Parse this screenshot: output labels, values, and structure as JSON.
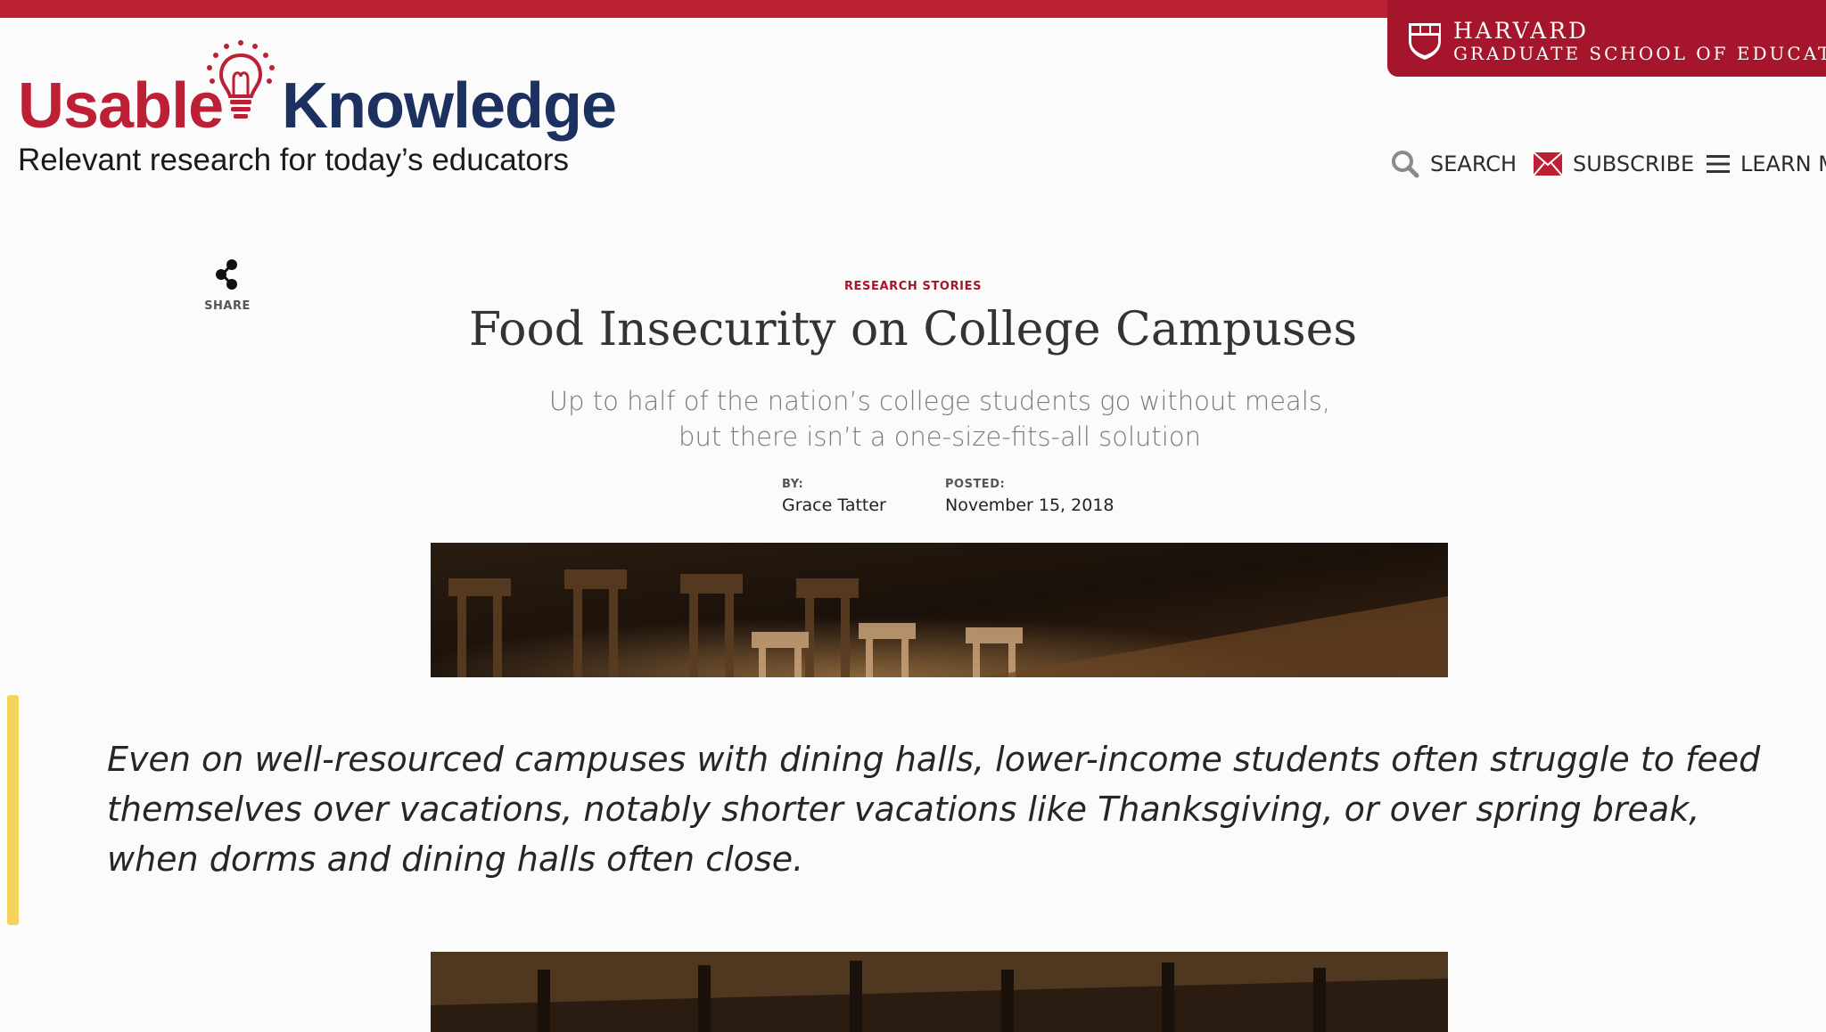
{
  "header": {
    "hgse_line1": "HARVARD",
    "hgse_line2": "GRADUATE SCHOOL OF EDUCATION",
    "logo_left": "Usable",
    "logo_right": "Knowledge",
    "tagline": "Relevant research for today’s educators"
  },
  "nav": {
    "search": "SEARCH",
    "subscribe": "SUBSCRIBE",
    "learn_more": "LEARN MORE"
  },
  "share": {
    "label": "SHARE"
  },
  "article": {
    "category": "RESEARCH STORIES",
    "title": "Food Insecurity on College Campuses",
    "subtitle": "Up to half of the nation’s college students go without meals, but there isn’t a one-size-fits-all solution",
    "by_label": "BY:",
    "author": "Grace Tatter",
    "posted_label": "POSTED:",
    "date": "November 15, 2018",
    "pull_quote": "Even on well-resourced campuses with dining halls, lower-income students often struggle to feed themselves over vacations, notably shorter vacations like Thanksgiving, or over spring break, when dorms and dining halls often close."
  },
  "colors": {
    "brand_red": "#bd1f34",
    "harvard_crimson": "#a5162c",
    "logo_navy": "#1c3160",
    "quote_accent": "#f3d35b"
  }
}
